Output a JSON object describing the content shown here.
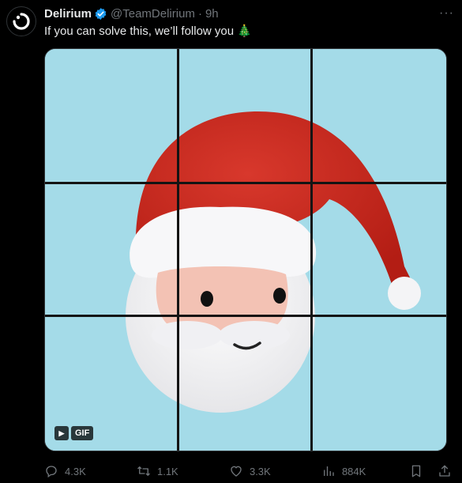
{
  "tweet": {
    "author_name": "Delirium",
    "handle": "@TeamDelirium",
    "separator": "·",
    "time": "9h",
    "text": "If you can solve this, we’ll follow you 🎄",
    "more": "···"
  },
  "media": {
    "gif_label": "GIF",
    "play_glyph": "▶",
    "background_color": "#a4dbe8",
    "puzzle_rows": 3,
    "puzzle_cols": 3
  },
  "actions": {
    "replies": "4.3K",
    "reposts": "1.1K",
    "likes": "3.3K",
    "views": "884K"
  },
  "icons": {
    "avatar": "delirium-logo-icon",
    "verified": "verified-badge-icon",
    "reply": "reply-icon",
    "repost": "repost-icon",
    "like": "heart-icon",
    "views": "views-bar-icon",
    "bookmark": "bookmark-icon",
    "share": "share-icon"
  },
  "colors": {
    "verified": "#1d9bf0",
    "muted": "#71767b",
    "text": "#e7e9ea"
  }
}
